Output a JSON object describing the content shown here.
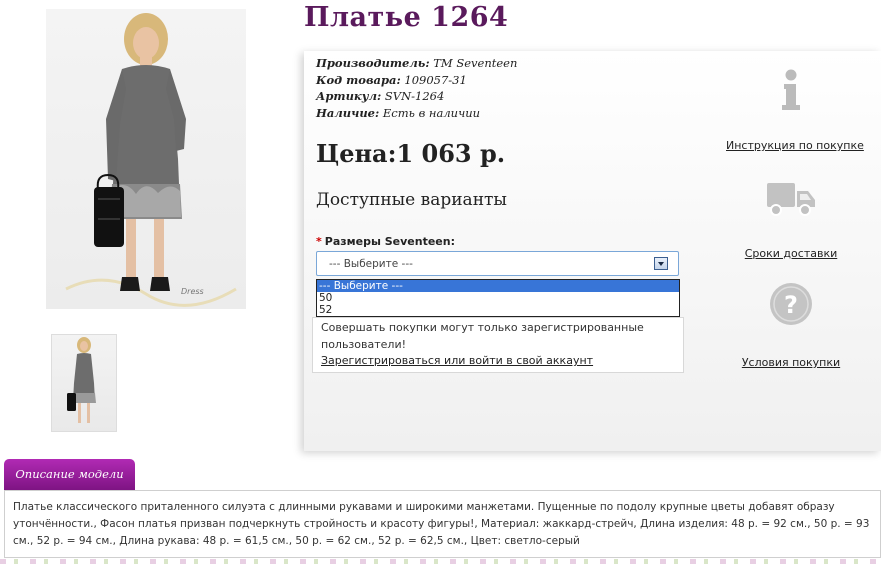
{
  "product": {
    "title": "Платье 1264",
    "meta": [
      {
        "label": "Производитель:",
        "value": "TM Seventeen"
      },
      {
        "label": "Код товара:",
        "value": "109057-31"
      },
      {
        "label": "Артикул:",
        "value": "SVN-1264"
      },
      {
        "label": "Наличие:",
        "value": "Есть в наличии"
      }
    ],
    "price": "Цена:1 063 р.",
    "variants_heading": "Доступные варианты",
    "size_label": "Размеры Seventeen:",
    "required_mark": "*",
    "select": {
      "value": "--- Выберите ---",
      "options": [
        "--- Выберите ---",
        "50",
        "52"
      ],
      "highlighted_index": 0
    },
    "notice": {
      "text": "Совершать покупки могут только зарегистрированные пользователи!",
      "link": "Зарегистрироваться или войти в свой аккаунт"
    }
  },
  "side_links": [
    {
      "icon": "info-icon",
      "label": "Инструкция по покупке"
    },
    {
      "icon": "truck-icon",
      "label": "Сроки доставки"
    },
    {
      "icon": "question-icon",
      "label": "Условия покупки"
    }
  ],
  "description": {
    "tab_label": "Описание модели",
    "text": "Платье классического приталенного силуэта с длинными рукавами и широкими манжетами. Пущенные по подолу крупные цветы добавят образу утончённости., Фасон платья призван подчеркнуть стройность и красоту фигуры!, Материал: жаккард-стрейч, Длина изделия: 48 р. = 92 см., 50 р. = 93 см., 52 р. = 94 см., Длина рукава: 48 р. = 61,5 см., 50 р. = 62 см., 52 р. = 62,5 см., Цвет: светло-серый"
  },
  "colors": {
    "title": "#5a1a5c",
    "tab": "#9a1f9e",
    "select_border": "#7aa7d8",
    "option_highlight": "#3875d7"
  }
}
